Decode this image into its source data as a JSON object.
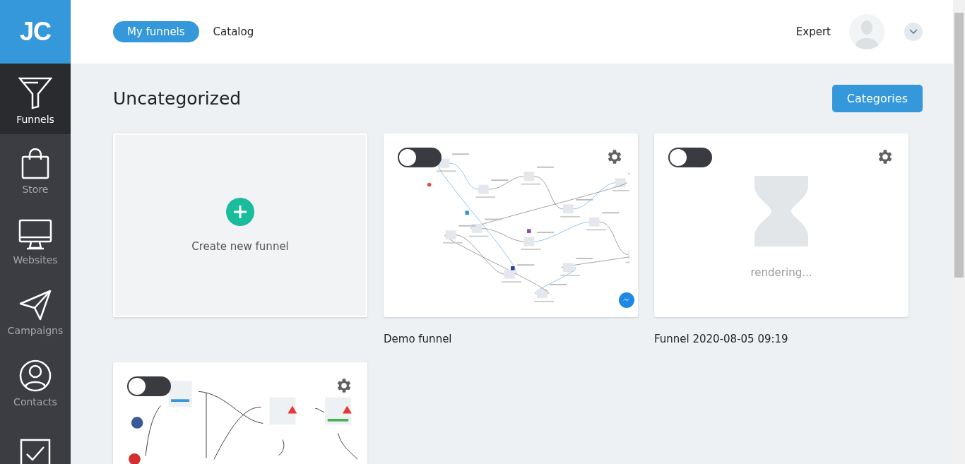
{
  "logo": "JC",
  "sidebar": {
    "items": [
      {
        "label": "Funnels",
        "selected": true
      },
      {
        "label": "Store",
        "selected": false
      },
      {
        "label": "Websites",
        "selected": false
      },
      {
        "label": "Campaigns",
        "selected": false
      },
      {
        "label": "Contacts",
        "selected": false
      },
      {
        "selected": false
      }
    ]
  },
  "header": {
    "tabs": [
      {
        "label": "My funnels",
        "selected": true
      },
      {
        "label": "Catalog",
        "selected": false
      }
    ],
    "plan": "Expert"
  },
  "section": {
    "title": "Uncategorized",
    "button": "Categories"
  },
  "cards": [
    {
      "kind": "create",
      "label": "Create new funnel"
    },
    {
      "kind": "preview",
      "name": "Demo funnel",
      "on": false
    },
    {
      "kind": "rendering",
      "status": "rendering...",
      "name": "Funnel 2020-08-05 09:19",
      "on": false
    },
    {
      "kind": "preview",
      "on": false
    }
  ]
}
